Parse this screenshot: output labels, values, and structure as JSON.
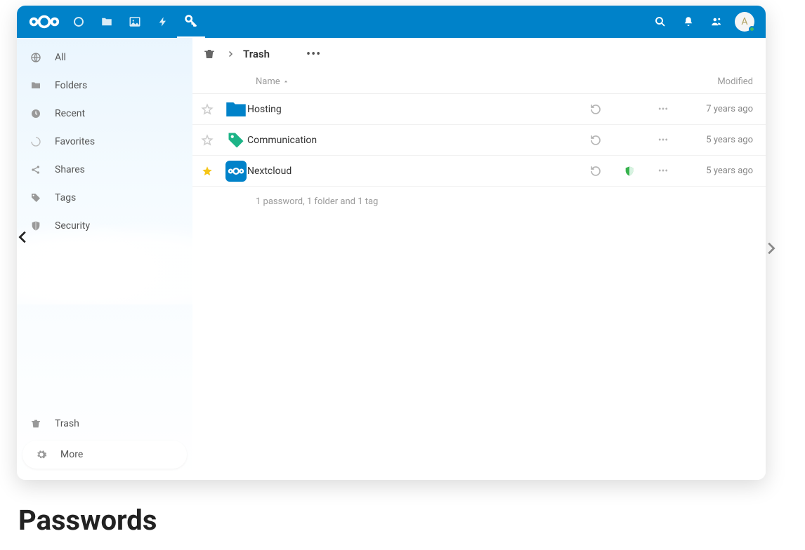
{
  "header": {
    "avatar_initial": "A"
  },
  "sidebar": {
    "items": [
      {
        "label": "All"
      },
      {
        "label": "Folders"
      },
      {
        "label": "Recent"
      },
      {
        "label": "Favorites"
      },
      {
        "label": "Shares"
      },
      {
        "label": "Tags"
      },
      {
        "label": "Security"
      }
    ],
    "trash_label": "Trash",
    "more_label": "More"
  },
  "breadcrumb": {
    "title": "Trash"
  },
  "table": {
    "name_header": "Name",
    "modified_header": "Modified",
    "rows": [
      {
        "name": "Hosting",
        "modified": "7 years ago",
        "type": "folder",
        "fav": false,
        "shield": false
      },
      {
        "name": "Communication",
        "modified": "5 years ago",
        "type": "tag",
        "fav": false,
        "shield": false
      },
      {
        "name": "Nextcloud",
        "modified": "5 years ago",
        "type": "password",
        "fav": true,
        "shield": true
      }
    ],
    "summary": "1 password, 1 folder and 1 tag"
  },
  "page_title": "Passwords"
}
